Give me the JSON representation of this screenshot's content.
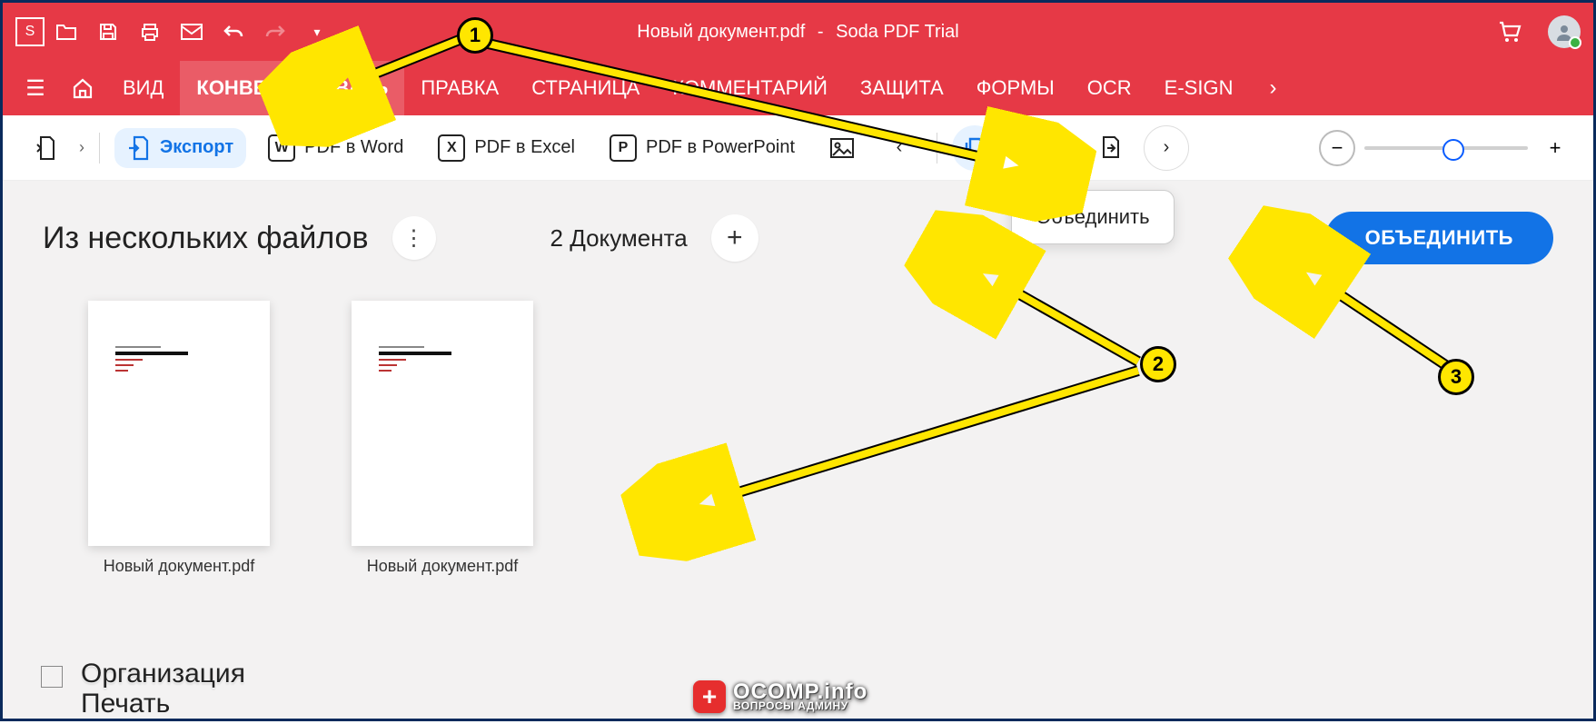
{
  "title": {
    "doc": "Новый документ.pdf",
    "sep": "-",
    "app": "Soda PDF Trial"
  },
  "quickbar": {
    "logo_letter": "S"
  },
  "tabs": {
    "view": "ВИД",
    "convert": "КОНВЕРТИРОВАТЬ",
    "edit": "ПРАВКА",
    "page": "СТРАНИЦА",
    "comment": "КОММЕНТАРИЙ",
    "protect": "ЗАЩИТА",
    "forms": "ФОРМЫ",
    "ocr": "OCR",
    "esign": "E-SIGN"
  },
  "subbar": {
    "export": "Экспорт",
    "to_word": "PDF в Word",
    "to_excel": "PDF в Excel",
    "to_ppt": "PDF в PowerPoint"
  },
  "tooltip": {
    "combine": "Объединить"
  },
  "panel": {
    "heading": "Из нескольких файлов",
    "count_label": "2 Документа",
    "merge_btn": "ОБЪЕДИНИТЬ"
  },
  "docs": [
    {
      "name": "Новый документ.pdf"
    },
    {
      "name": "Новый документ.pdf"
    }
  ],
  "peek": {
    "line1": "Организация",
    "line2": "Печать"
  },
  "watermark": {
    "domain": "OCOMP.info",
    "tag": "ВОПРОСЫ АДМИНУ"
  },
  "markers": {
    "m1": "1",
    "m2": "2",
    "m3": "3"
  }
}
